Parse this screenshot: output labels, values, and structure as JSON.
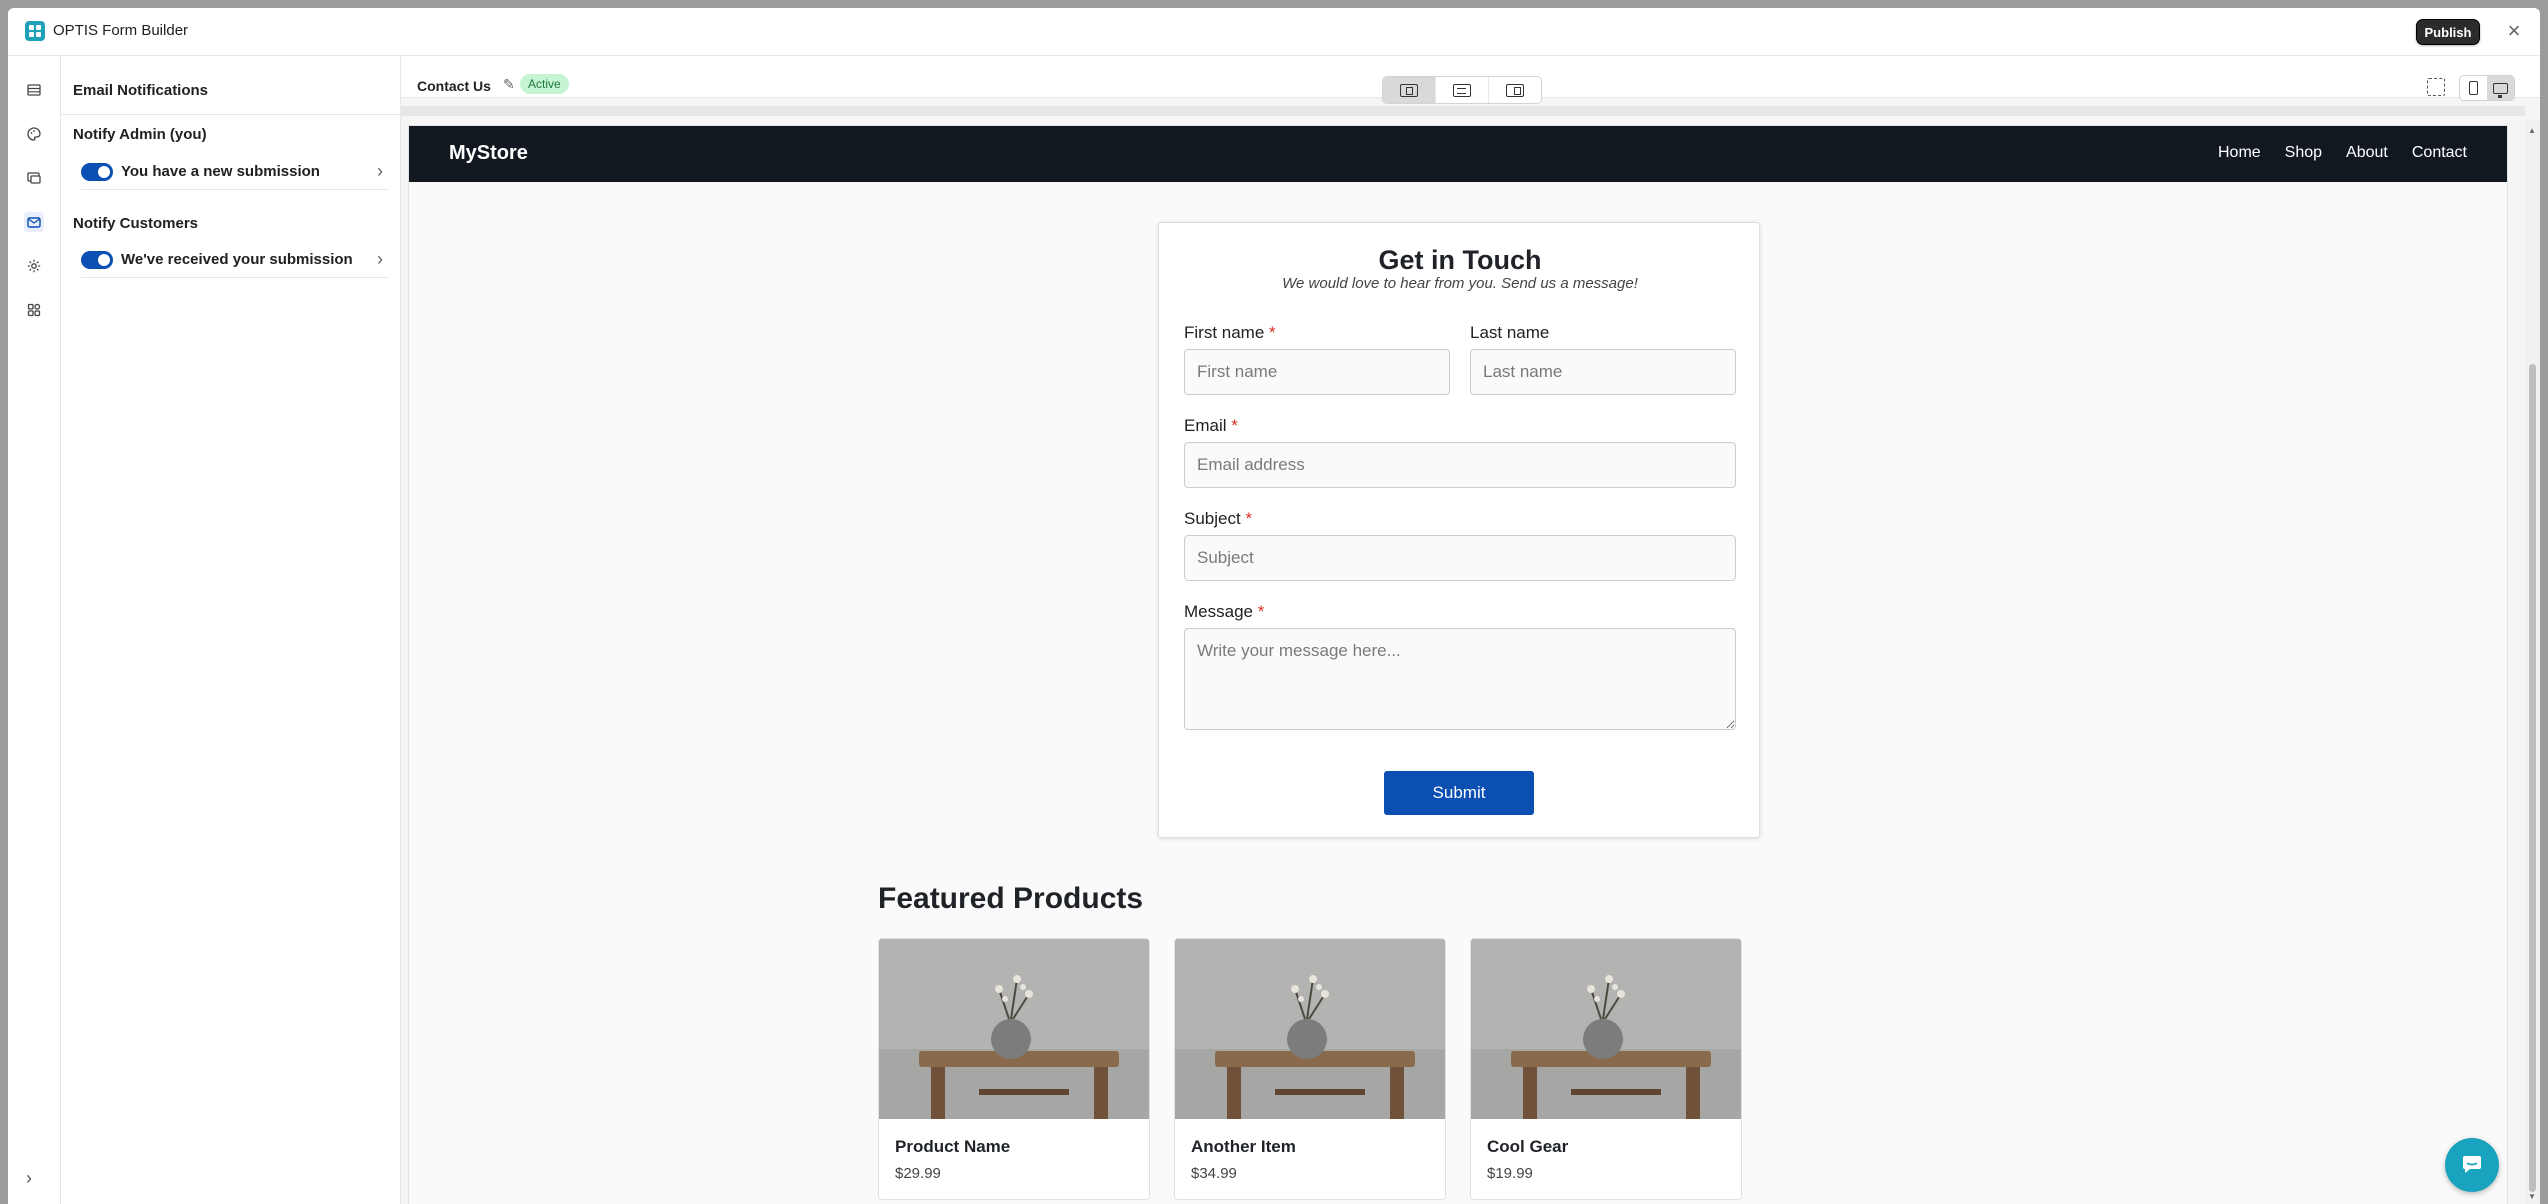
{
  "app": {
    "title": "OPTIS Form Builder",
    "publish_label": "Publish",
    "close_glyph": "×"
  },
  "rail": {
    "icons": [
      "list-icon",
      "palette-icon",
      "integrations-icon",
      "mail-icon",
      "gear-icon",
      "apps-icon"
    ],
    "active": "mail-icon",
    "expand_glyph": "›"
  },
  "panel": {
    "title": "Email Notifications",
    "groups": [
      {
        "title": "Notify Admin (you)",
        "items": [
          {
            "label": "You have a new submission",
            "enabled": true
          }
        ]
      },
      {
        "title": "Notify Customers",
        "items": [
          {
            "label": "We've received your submission",
            "enabled": true
          }
        ]
      }
    ]
  },
  "editor": {
    "form_name": "Contact Us",
    "status": "Active",
    "pencil_glyph": "✎"
  },
  "site": {
    "brand": "MyStore",
    "nav": [
      "Home",
      "Shop",
      "About",
      "Contact"
    ],
    "form": {
      "title": "Get in Touch",
      "subtitle": "We would love to hear from you. Send us a message!",
      "fields": {
        "first_name": {
          "label": "First name",
          "placeholder": "First name",
          "required": "*"
        },
        "last_name": {
          "label": "Last name",
          "placeholder": "Last name"
        },
        "email": {
          "label": "Email",
          "placeholder": "Email address",
          "required": "*"
        },
        "subject": {
          "label": "Subject",
          "placeholder": "Subject",
          "required": "*"
        },
        "message": {
          "label": "Message",
          "placeholder": "Write your message here...",
          "required": "*"
        }
      },
      "submit_label": "Submit"
    },
    "featured": {
      "title": "Featured Products",
      "products": [
        {
          "name": "Product Name",
          "price": "$29.99"
        },
        {
          "name": "Another Item",
          "price": "$34.99"
        },
        {
          "name": "Cool Gear",
          "price": "$19.99"
        }
      ]
    }
  },
  "colors": {
    "accent": "#0b4fb3",
    "nav_bg": "#111820",
    "badge_bg": "#c6f3d2",
    "chat": "#1aa3bf"
  }
}
